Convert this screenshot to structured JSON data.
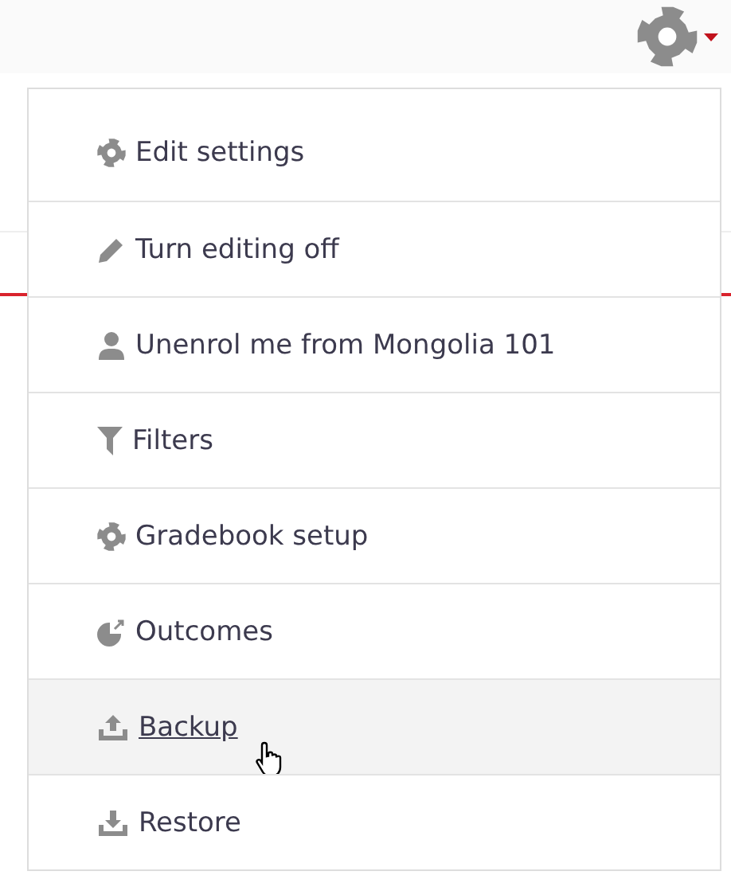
{
  "menu": {
    "items": [
      {
        "label": "Edit settings",
        "hovered": false
      },
      {
        "label": "Turn editing off",
        "hovered": false
      },
      {
        "label": "Unenrol me from Mongolia 101",
        "hovered": false
      },
      {
        "label": "Filters",
        "hovered": false
      },
      {
        "label": "Gradebook setup",
        "hovered": false
      },
      {
        "label": "Outcomes",
        "hovered": false
      },
      {
        "label": "Backup",
        "hovered": true
      },
      {
        "label": "Restore",
        "hovered": false
      }
    ]
  }
}
